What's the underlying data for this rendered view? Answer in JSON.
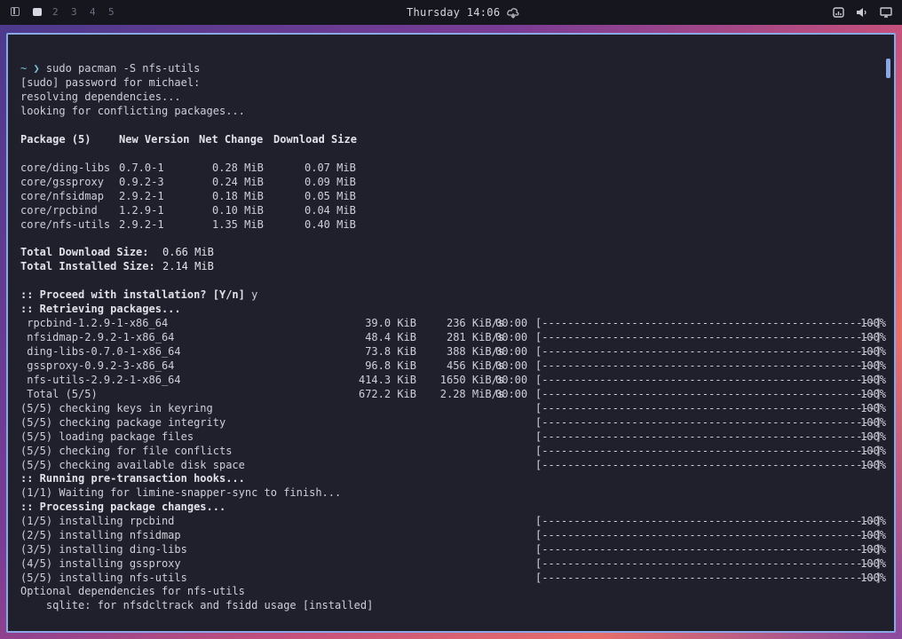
{
  "topbar": {
    "workspaces": [
      "2",
      "3",
      "4",
      "5"
    ],
    "clock": "Thursday 14:06"
  },
  "terminal": {
    "prompt_symbol": "~ ❯",
    "command": "sudo pacman -S nfs-utils",
    "preamble": [
      "[sudo] password for michael:",
      "resolving dependencies...",
      "looking for conflicting packages..."
    ],
    "table_header": {
      "package": "Package (5)",
      "new_version": "New Version",
      "net_change": "Net Change",
      "download_size": "Download Size"
    },
    "packages": [
      {
        "name": "core/ding-libs",
        "version": "0.7.0-1",
        "net": "0.28 MiB",
        "dl": "0.07 MiB"
      },
      {
        "name": "core/gssproxy",
        "version": "0.9.2-3",
        "net": "0.24 MiB",
        "dl": "0.09 MiB"
      },
      {
        "name": "core/nfsidmap",
        "version": "2.9.2-1",
        "net": "0.18 MiB",
        "dl": "0.05 MiB"
      },
      {
        "name": "core/rpcbind",
        "version": "1.2.9-1",
        "net": "0.10 MiB",
        "dl": "0.04 MiB"
      },
      {
        "name": "core/nfs-utils",
        "version": "2.9.2-1",
        "net": "1.35 MiB",
        "dl": "0.40 MiB"
      }
    ],
    "totals": {
      "download_label": "Total Download Size:",
      "download_value": "0.66 MiB",
      "installed_label": "Total Installed Size:",
      "installed_value": "2.14 MiB"
    },
    "proceed_prompt": ":: Proceed with installation? [Y/n]",
    "proceed_answer": " y",
    "retrieving": ":: Retrieving packages...",
    "progress_bar": "[----------------------------------------------------]",
    "downloads": [
      {
        "name": " rpcbind-1.2.9-1-x86_64",
        "size": "39.0 KiB",
        "rate": "236 KiB/s",
        "time": "00:00",
        "pct": "100%"
      },
      {
        "name": " nfsidmap-2.9.2-1-x86_64",
        "size": "48.4 KiB",
        "rate": "281 KiB/s",
        "time": "00:00",
        "pct": "100%"
      },
      {
        "name": " ding-libs-0.7.0-1-x86_64",
        "size": "73.8 KiB",
        "rate": "388 KiB/s",
        "time": "00:00",
        "pct": "100%"
      },
      {
        "name": " gssproxy-0.9.2-3-x86_64",
        "size": "96.8 KiB",
        "rate": "456 KiB/s",
        "time": "00:00",
        "pct": "100%"
      },
      {
        "name": " nfs-utils-2.9.2-1-x86_64",
        "size": "414.3 KiB",
        "rate": "1650 KiB/s",
        "time": "00:00",
        "pct": "100%"
      },
      {
        "name": " Total (5/5)",
        "size": "672.2 KiB",
        "rate": "2.28 MiB/s",
        "time": "00:00",
        "pct": "100%"
      }
    ],
    "checks": [
      {
        "text": "(5/5) checking keys in keyring",
        "pct": "100%"
      },
      {
        "text": "(5/5) checking package integrity",
        "pct": "100%"
      },
      {
        "text": "(5/5) loading package files",
        "pct": "100%"
      },
      {
        "text": "(5/5) checking for file conflicts",
        "pct": "100%"
      },
      {
        "text": "(5/5) checking available disk space",
        "pct": "100%"
      }
    ],
    "pre_hooks": ":: Running pre-transaction hooks...",
    "waiting": "(1/1) Waiting for limine-snapper-sync to finish...",
    "processing": ":: Processing package changes...",
    "installs": [
      {
        "text": "(1/5) installing rpcbind",
        "pct": "100%"
      },
      {
        "text": "(2/5) installing nfsidmap",
        "pct": "100%"
      },
      {
        "text": "(3/5) installing ding-libs",
        "pct": "100%"
      },
      {
        "text": "(4/5) installing gssproxy",
        "pct": "100%"
      },
      {
        "text": "(5/5) installing nfs-utils",
        "pct": "100%"
      }
    ],
    "optional_header": "Optional dependencies for nfs-utils",
    "optional_item": "    sqlite: for nfsdcltrack and fsidd usage [installed]"
  }
}
